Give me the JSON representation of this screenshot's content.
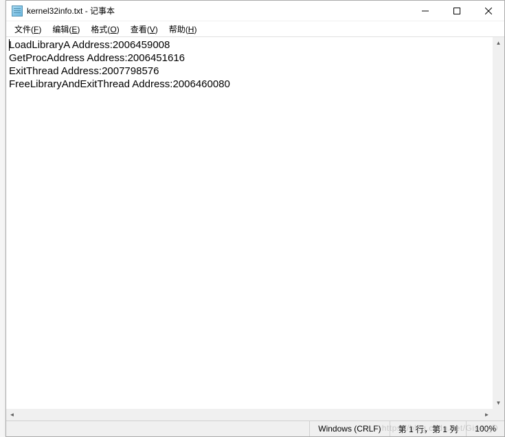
{
  "titlebar": {
    "icon_name": "notepad-icon",
    "title": "kernel32info.txt - 记事本"
  },
  "window_controls": {
    "minimize": "minimize",
    "maximize": "maximize",
    "close": "close"
  },
  "menubar": {
    "items": [
      {
        "label": "文件",
        "hotkey": "F"
      },
      {
        "label": "编辑",
        "hotkey": "E"
      },
      {
        "label": "格式",
        "hotkey": "O"
      },
      {
        "label": "查看",
        "hotkey": "V"
      },
      {
        "label": "帮助",
        "hotkey": "H"
      }
    ]
  },
  "content": {
    "lines": [
      "LoadLibraryA Address:2006459008",
      "GetProcAddress Address:2006451616",
      "ExitThread Address:2007798576",
      "FreeLibraryAndExitThread Address:2006460080"
    ]
  },
  "statusbar": {
    "encoding": "Windows (CRLF)",
    "position": "第 1 行，第 1 列",
    "zoom": "100%"
  },
  "watermark": "https://blog.csdn.net/Giser_D"
}
